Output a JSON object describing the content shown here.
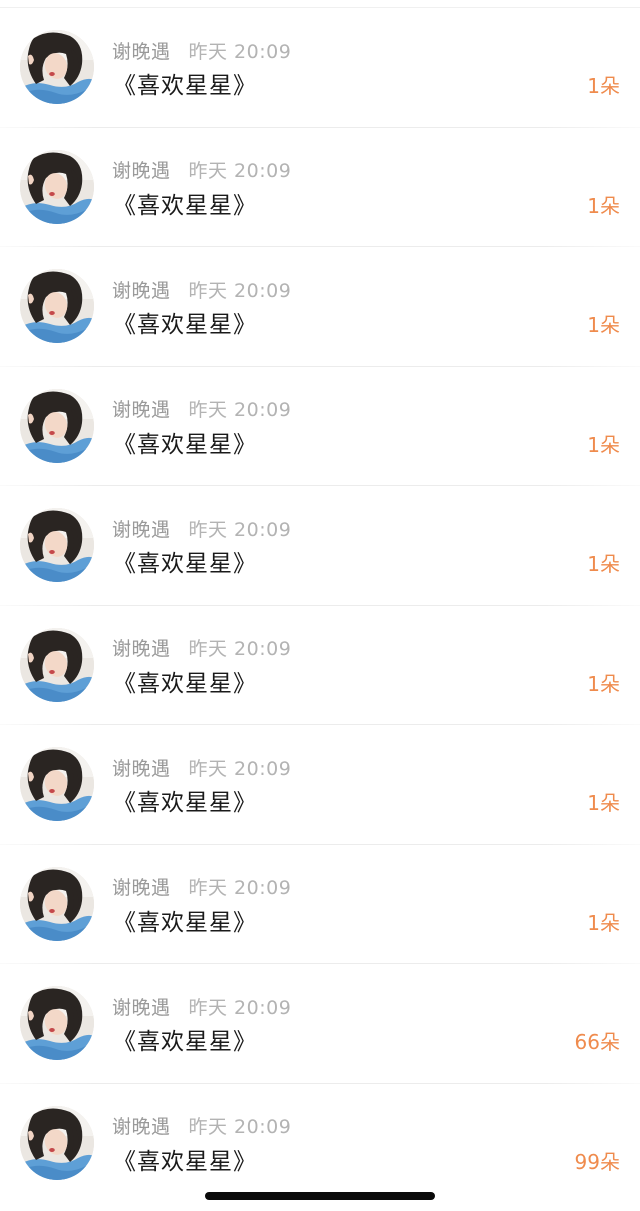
{
  "gifts": [
    {
      "name": "谢晚遇",
      "time": "昨天 20:09",
      "title": "《喜欢星星》",
      "count": "1朵"
    },
    {
      "name": "谢晚遇",
      "time": "昨天 20:09",
      "title": "《喜欢星星》",
      "count": "1朵"
    },
    {
      "name": "谢晚遇",
      "time": "昨天 20:09",
      "title": "《喜欢星星》",
      "count": "1朵"
    },
    {
      "name": "谢晚遇",
      "time": "昨天 20:09",
      "title": "《喜欢星星》",
      "count": "1朵"
    },
    {
      "name": "谢晚遇",
      "time": "昨天 20:09",
      "title": "《喜欢星星》",
      "count": "1朵"
    },
    {
      "name": "谢晚遇",
      "time": "昨天 20:09",
      "title": "《喜欢星星》",
      "count": "1朵"
    },
    {
      "name": "谢晚遇",
      "time": "昨天 20:09",
      "title": "《喜欢星星》",
      "count": "1朵"
    },
    {
      "name": "谢晚遇",
      "time": "昨天 20:09",
      "title": "《喜欢星星》",
      "count": "1朵"
    },
    {
      "name": "谢晚遇",
      "time": "昨天 20:09",
      "title": "《喜欢星星》",
      "count": "66朵"
    },
    {
      "name": "谢晚遇",
      "time": "昨天 20:09",
      "title": "《喜欢星星》",
      "count": "99朵"
    }
  ],
  "colors": {
    "count": "#ef8b4d",
    "name": "#999999",
    "time": "#b3b3b3",
    "title": "#1a1a1a"
  },
  "icons": {
    "avatar": "user-photo-avatar"
  }
}
